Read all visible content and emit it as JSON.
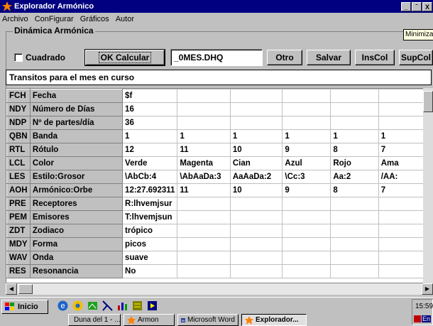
{
  "window": {
    "title": "Explorador Armónico",
    "controls": [
      "_",
      "̄",
      "X"
    ]
  },
  "menu": [
    {
      "label": "Archivo"
    },
    {
      "label": "ConFigurar"
    },
    {
      "label": "Gráficos"
    },
    {
      "label": "Autor"
    }
  ],
  "group": {
    "label": "Dinámica Armónica"
  },
  "tooltip": "Minimizar",
  "toolbar": {
    "checkbox_label": "Cuadrado",
    "ok_label": "OK Calcular",
    "file_value": "_0MES.DHQ",
    "otro_label": "Otro",
    "salvar_label": "Salvar",
    "inscol_label": "InsCol",
    "supcol_label": "SupCol"
  },
  "transit_text": "Transitos para el mes en curso",
  "grid": {
    "rows": [
      {
        "code": "FCH",
        "label": "Fecha",
        "cells": [
          "$f",
          "",
          "",
          "",
          "",
          ""
        ]
      },
      {
        "code": "NDY",
        "label": "Número de Días",
        "cells": [
          "16",
          "",
          "",
          "",
          "",
          ""
        ]
      },
      {
        "code": "NDP",
        "label": "Nº de partes/día",
        "cells": [
          "36",
          "",
          "",
          "",
          "",
          ""
        ]
      },
      {
        "code": "QBN",
        "label": "Banda",
        "cells": [
          "1",
          "1",
          "1",
          "1",
          "1",
          "1"
        ]
      },
      {
        "code": "RTL",
        "label": "Rótulo",
        "cells": [
          "12",
          "11",
          "10",
          "9",
          "8",
          "7"
        ]
      },
      {
        "code": "LCL",
        "label": "Color",
        "cells": [
          "Verde",
          "Magenta",
          "Cian",
          "Azul",
          "Rojo",
          "Ama"
        ]
      },
      {
        "code": "LES",
        "label": "Estilo:Grosor",
        "cells": [
          "\\AbCb:4",
          "\\AbAaDa:3",
          "AaAaDa:2",
          "\\Cc:3",
          "Aa:2",
          "/AA:"
        ]
      },
      {
        "code": "AOH",
        "label": "Armónico:Orbe",
        "cells": [
          "12:27.692311",
          "11",
          "10",
          "9",
          "8",
          "7"
        ]
      },
      {
        "code": "PRE",
        "label": "Receptores",
        "cells": [
          "R:lhvemjsur",
          "",
          "",
          "",
          "",
          ""
        ]
      },
      {
        "code": "PEM",
        "label": "Emisores",
        "cells": [
          "T:lhvemjsun",
          "",
          "",
          "",
          "",
          ""
        ]
      },
      {
        "code": "ZDT",
        "label": "Zodiaco",
        "cells": [
          "trópico",
          "",
          "",
          "",
          "",
          ""
        ]
      },
      {
        "code": "MDY",
        "label": "Forma",
        "cells": [
          "picos",
          "",
          "",
          "",
          "",
          ""
        ]
      },
      {
        "code": "WAV",
        "label": "Onda",
        "cells": [
          "suave",
          "",
          "",
          "",
          "",
          ""
        ]
      },
      {
        "code": "RES",
        "label": "Resonancia",
        "cells": [
          "No",
          "",
          "",
          "",
          "",
          ""
        ]
      }
    ]
  },
  "taskbar": {
    "start_label": "Inicio",
    "quicklaunch_icons": [
      "ie-icon",
      "outlook-icon",
      "desktop-icon",
      "channel-icon",
      "chart-icon",
      "calc-icon",
      "media-icon"
    ],
    "tasks": [
      {
        "label": "Duna del 1 - ...",
        "icon": "document-icon"
      },
      {
        "label": "Armon",
        "icon": "star-icon"
      },
      {
        "label": "Microsoft Word",
        "icon": "word-icon"
      },
      {
        "label": "Explorador...",
        "icon": "star-icon"
      }
    ],
    "clock": "15:59",
    "tray_label": "En"
  },
  "colors": {
    "titlebar": "#000080",
    "face": "#c0c0c0",
    "tooltip": "#ffffe1"
  }
}
